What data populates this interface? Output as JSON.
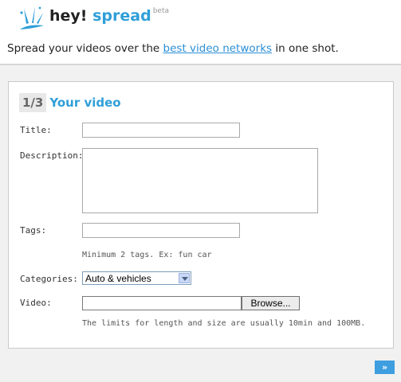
{
  "brand": {
    "hey": "hey!",
    "spread": "spread",
    "beta": "beta"
  },
  "tagline": {
    "before": "Spread your videos over the ",
    "link": "best video networks",
    "after": " in one shot."
  },
  "step": {
    "number": "1/3",
    "title": "Your video"
  },
  "form": {
    "title_label": "Title:",
    "title_value": "",
    "description_label": "Description:",
    "description_value": "",
    "tags_label": "Tags:",
    "tags_value": "",
    "tags_hint": "Minimum 2 tags. Ex: fun car",
    "categories_label": "Categories:",
    "category_selected": "Auto & vehicles",
    "video_label": "Video:",
    "browse_label": "Browse...",
    "video_hint": "The limits for length and size are usually 10min and 100MB."
  },
  "next_label": "»",
  "colors": {
    "accent": "#2f9fd8",
    "link": "#2c8fd6",
    "next_button": "#3e9ee0"
  }
}
